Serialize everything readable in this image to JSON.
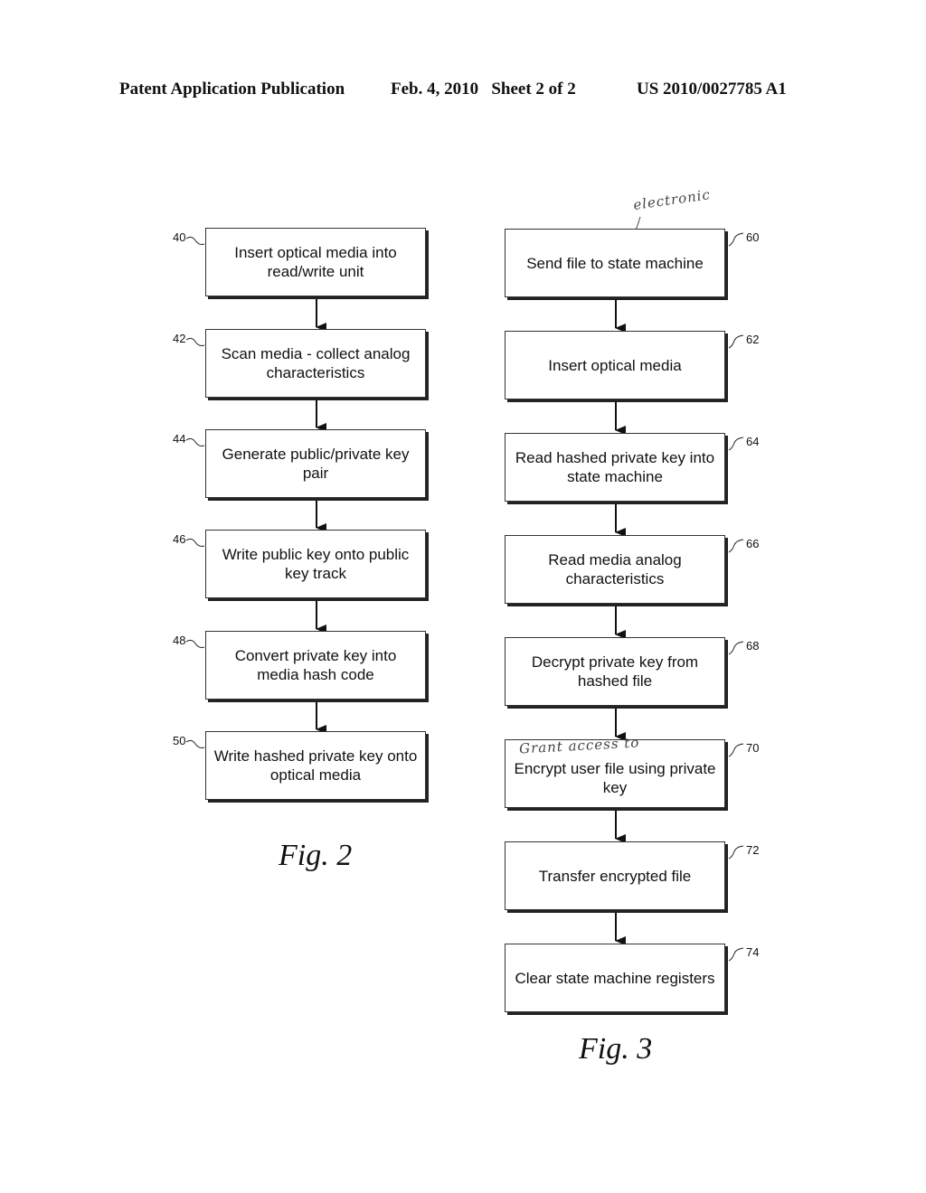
{
  "header": {
    "publication": "Patent Application Publication",
    "date_sheet": "Feb. 4, 2010   Sheet 2 of 2",
    "number": "US 2010/0027785 A1"
  },
  "fig2": {
    "caption": "Fig. 2",
    "steps": [
      {
        "ref": "40",
        "text": "Insert optical media into read/write unit"
      },
      {
        "ref": "42",
        "text": "Scan media - collect analog characteristics"
      },
      {
        "ref": "44",
        "text": "Generate public/private key pair"
      },
      {
        "ref": "46",
        "text": "Write public key onto public key track"
      },
      {
        "ref": "48",
        "text": "Convert private key into media hash code"
      },
      {
        "ref": "50",
        "text": "Write hashed private key onto optical media"
      }
    ]
  },
  "fig3": {
    "caption": "Fig. 3",
    "steps": [
      {
        "ref": "60",
        "text": "Send file to state machine"
      },
      {
        "ref": "62",
        "text": "Insert optical media"
      },
      {
        "ref": "64",
        "text": "Read hashed private key into state machine"
      },
      {
        "ref": "66",
        "text": "Read media analog characteristics"
      },
      {
        "ref": "68",
        "text": "Decrypt private key from hashed file"
      },
      {
        "ref": "70",
        "text": "Encrypt user file using private key"
      },
      {
        "ref": "72",
        "text": "Transfer encrypted file"
      },
      {
        "ref": "74",
        "text": "Clear state machine registers"
      }
    ],
    "annotations": {
      "step60": "electronic",
      "step70": "Grant access to"
    }
  }
}
